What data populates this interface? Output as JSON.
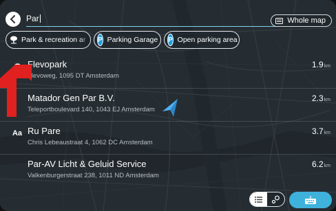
{
  "search": {
    "value": "Par"
  },
  "scope_button": {
    "label": "Whole map",
    "icon": "map-grid-icon"
  },
  "chips": [
    {
      "label": "Park & recreation ar",
      "icon": "tree-icon"
    },
    {
      "label": "Parking Garage",
      "icon": "parking-icon"
    },
    {
      "label": "Open parking area",
      "icon": "parking-icon"
    }
  ],
  "results": [
    {
      "name": "Flevopark",
      "address": "Flevoweg, 1095 DT Amsterdam",
      "distance": "1.9",
      "unit": "km",
      "icon": "tree-icon"
    },
    {
      "name": "Matador Gen Par B.V.",
      "address": "Teleportboulevard 140, 1043 EJ Amsterdam",
      "distance": "2.3",
      "unit": "km",
      "icon": ""
    },
    {
      "name": "Ru Pare",
      "address": "Chris Lebeaustraat 4, 1062 DC Amsterdam",
      "distance": "3.7",
      "unit": "km",
      "icon": "Aa"
    },
    {
      "name": "Par-AV Licht & Geluid Service",
      "address": "Valkenburgerstraat 238, 1011 ND Amsterdam",
      "distance": "6.2",
      "unit": "km",
      "icon": ""
    }
  ],
  "colors": {
    "accent": "#3fb2dc",
    "chip_blue": "#1e9ee0",
    "underline": "#7dd3f0",
    "annotation_arrow": "#e0211f"
  }
}
